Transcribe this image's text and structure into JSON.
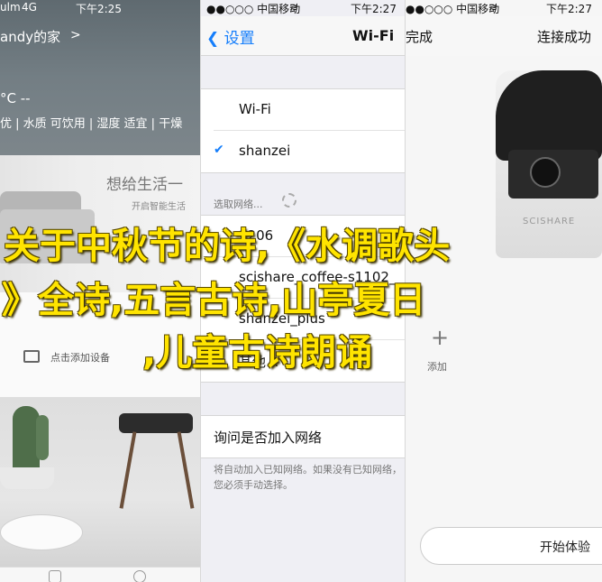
{
  "panel1": {
    "status": {
      "signal": "ulm",
      "carrier": "4G",
      "time": "下午2:25"
    },
    "home_title": "andy的家",
    "home_chevron": ">",
    "temperature": "°C --",
    "air_info": "优 | 水质 可饮用 | 湿度 适宜 | 干燥",
    "room_title": "想给生活一",
    "room_subtitle": "开启智能生活",
    "add_device_label": "点击添加设备"
  },
  "panel2": {
    "status": {
      "carrier": "●●○○○ 中国移动",
      "wifi": "wifi",
      "time": "下午2:27"
    },
    "back_label": "设置",
    "title": "Wi-Fi",
    "wifi_label": "Wi-Fi",
    "connected_network": "shanzei",
    "choose_network_header": "选取网络...",
    "networks": [
      "1206",
      "scishare_coffee-s1102_",
      "shanzei_plus",
      "其他..."
    ],
    "ask_join_label": "询问是否加入网络",
    "ask_join_note": "将自动加入已知网络。如果没有已知网络，您必须手动选择。"
  },
  "panel3": {
    "status": {
      "carrier": "●●○○○ 中国移动",
      "wifi": "wifi",
      "time": "下午2:27"
    },
    "done_label": "完成",
    "title": "连接成功",
    "device_brand": "SCISHARE",
    "add_icon": "+",
    "add_label": "添加",
    "experience_button": "开始体验"
  },
  "overlay": {
    "line1": "关于中秋节的诗,《水调歌头",
    "line2": "》全诗,五言古诗,山亭夏日",
    "line3": ",儿童古诗朗诵"
  }
}
